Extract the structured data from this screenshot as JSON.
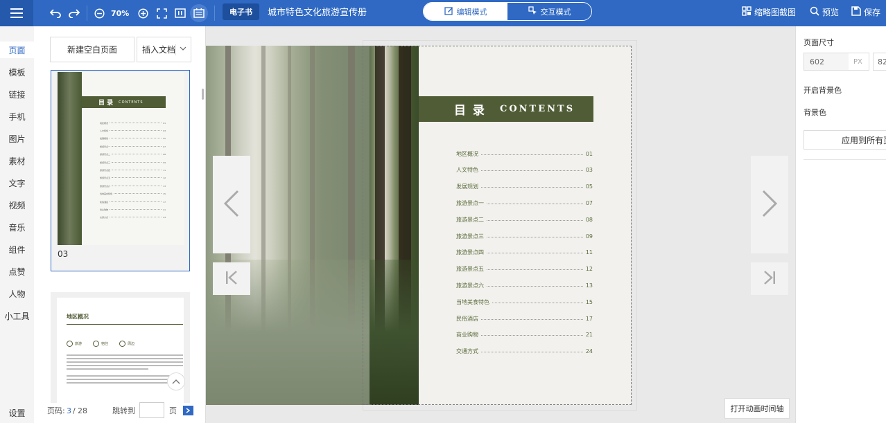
{
  "toolbar": {
    "menu_icon": "hamburger-menu-icon",
    "undo_icon": "undo-icon",
    "redo_icon": "redo-icon",
    "zoom_out_icon": "zoom-out-icon",
    "zoom_level": "70%",
    "zoom_in_icon": "zoom-in-icon",
    "fullscreen_icon": "fullscreen-icon",
    "page_size_icon": "fit-page-icon",
    "single_page_icon": "single-page-icon",
    "ebook_tag": "电子书",
    "document_title": "城市特色文化旅游宣传册",
    "mode_edit": "编辑模式",
    "mode_interactive": "交互模式",
    "thumbnail_screenshot": "缩略图截图",
    "preview": "预览",
    "save": "保存"
  },
  "left_nav": {
    "items": [
      "页面",
      "模板",
      "链接",
      "手机",
      "图片",
      "素材",
      "文字",
      "视频",
      "音乐",
      "组件",
      "点赞",
      "人物",
      "小工具"
    ],
    "active": "页面",
    "settings": "设置"
  },
  "pages_panel": {
    "new_blank_page": "新建空白页面",
    "insert_document": "插入文档",
    "thumbnail_1": {
      "page_number": "03",
      "heading_cn": "目 录",
      "heading_en": "CONTENTS"
    },
    "thumbnail_2": {
      "heading": "地区概况",
      "tags": [
        "旅游",
        "宿住",
        "周边"
      ]
    },
    "pager": {
      "label": "页码:",
      "current": "3",
      "separator": "/",
      "total": "28",
      "jump_label": "跳转到",
      "page_suffix": "页",
      "go_icon": "arrow-right-icon"
    }
  },
  "canvas": {
    "contents_heading_cn": "目 录",
    "contents_heading_en": "CONTENTS",
    "toc": [
      {
        "title": "地区概况",
        "page": "01"
      },
      {
        "title": "人文特色",
        "page": "03"
      },
      {
        "title": "发展规划",
        "page": "05"
      },
      {
        "title": "旅游景点一",
        "page": "07"
      },
      {
        "title": "旅游景点二",
        "page": "08"
      },
      {
        "title": "旅游景点三",
        "page": "09"
      },
      {
        "title": "旅游景点四",
        "page": "11"
      },
      {
        "title": "旅游景点五",
        "page": "12"
      },
      {
        "title": "旅游景点六",
        "page": "13"
      },
      {
        "title": "当地美食特色",
        "page": "15"
      },
      {
        "title": "民俗酒店",
        "page": "17"
      },
      {
        "title": "商业购物",
        "page": "21"
      },
      {
        "title": "交通方式",
        "page": "24"
      }
    ],
    "open_animation_timeline": "打开动画时间轴"
  },
  "properties_panel": {
    "page_size_label": "页面尺寸",
    "width_value": "602",
    "unit": "PX",
    "height_value": "82",
    "enable_bg_label": "开启背景色",
    "bg_color_label": "背景色",
    "apply_all": "应用到所有页"
  },
  "colors": {
    "topbar": "#2f69c3",
    "toc_band": "#505c35",
    "toc_text": "#5b6d3d"
  }
}
